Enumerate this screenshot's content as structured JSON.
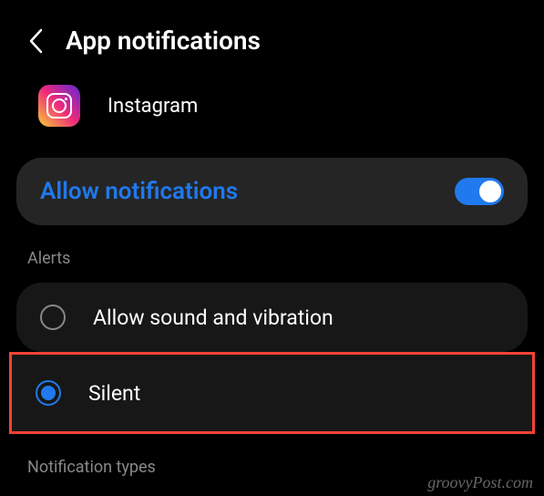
{
  "header": {
    "title": "App notifications"
  },
  "app": {
    "name": "Instagram"
  },
  "allow": {
    "label": "Allow notifications",
    "enabled": true
  },
  "sections": {
    "alerts": "Alerts",
    "types": "Notification types"
  },
  "alert_options": {
    "sound": "Allow sound and vibration",
    "silent": "Silent",
    "selected": "silent"
  },
  "watermark": "groovyPost.com"
}
